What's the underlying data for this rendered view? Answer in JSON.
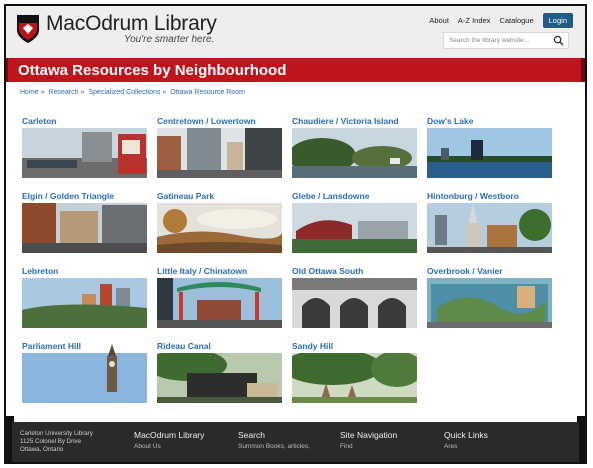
{
  "header": {
    "title": "MacOdrum Library",
    "tagline": "You're smarter here.",
    "links": [
      "About",
      "A-Z Index",
      "Catalogue"
    ],
    "login": "Login",
    "search_placeholder": "Search the library website..."
  },
  "banner": {
    "title": "Ottawa Resources by Neighbourhood"
  },
  "breadcrumb": [
    "Home",
    "Research",
    "Specialized Collections",
    "Ottawa Resource Room"
  ],
  "neighbourhoods": [
    "Carleton",
    "Centretown / Lowertown",
    "Chaudiere / Victoria Island",
    "Dow's Lake",
    "Elgin / Golden Triangle",
    "Gatineau Park",
    "Glebe / Lansdowne",
    "Hintonburg / Westboro",
    "Lebreton",
    "Little Italy / Chinatown",
    "Old Ottawa South",
    "Overbrook / Vanier",
    "Parliament Hill",
    "Rideau Canal",
    "Sandy Hill"
  ],
  "footer": {
    "address": [
      "Carleton University Library",
      "1125 Colonel By Drive",
      "Ottawa, Ontario"
    ],
    "col1": {
      "heading": "MacOdrum Library",
      "sub": "About Us"
    },
    "col2": {
      "heading": "Search",
      "sub": "Summon Books, articles,"
    },
    "col3": {
      "heading": "Site Navigation",
      "sub": "Find"
    },
    "col4": {
      "heading": "Quick Links",
      "sub": "Ares"
    }
  },
  "colors": {
    "banner": "#c0141c",
    "link": "#2a6db0",
    "login": "#1f5d86",
    "footer": "#2a2a2a"
  }
}
